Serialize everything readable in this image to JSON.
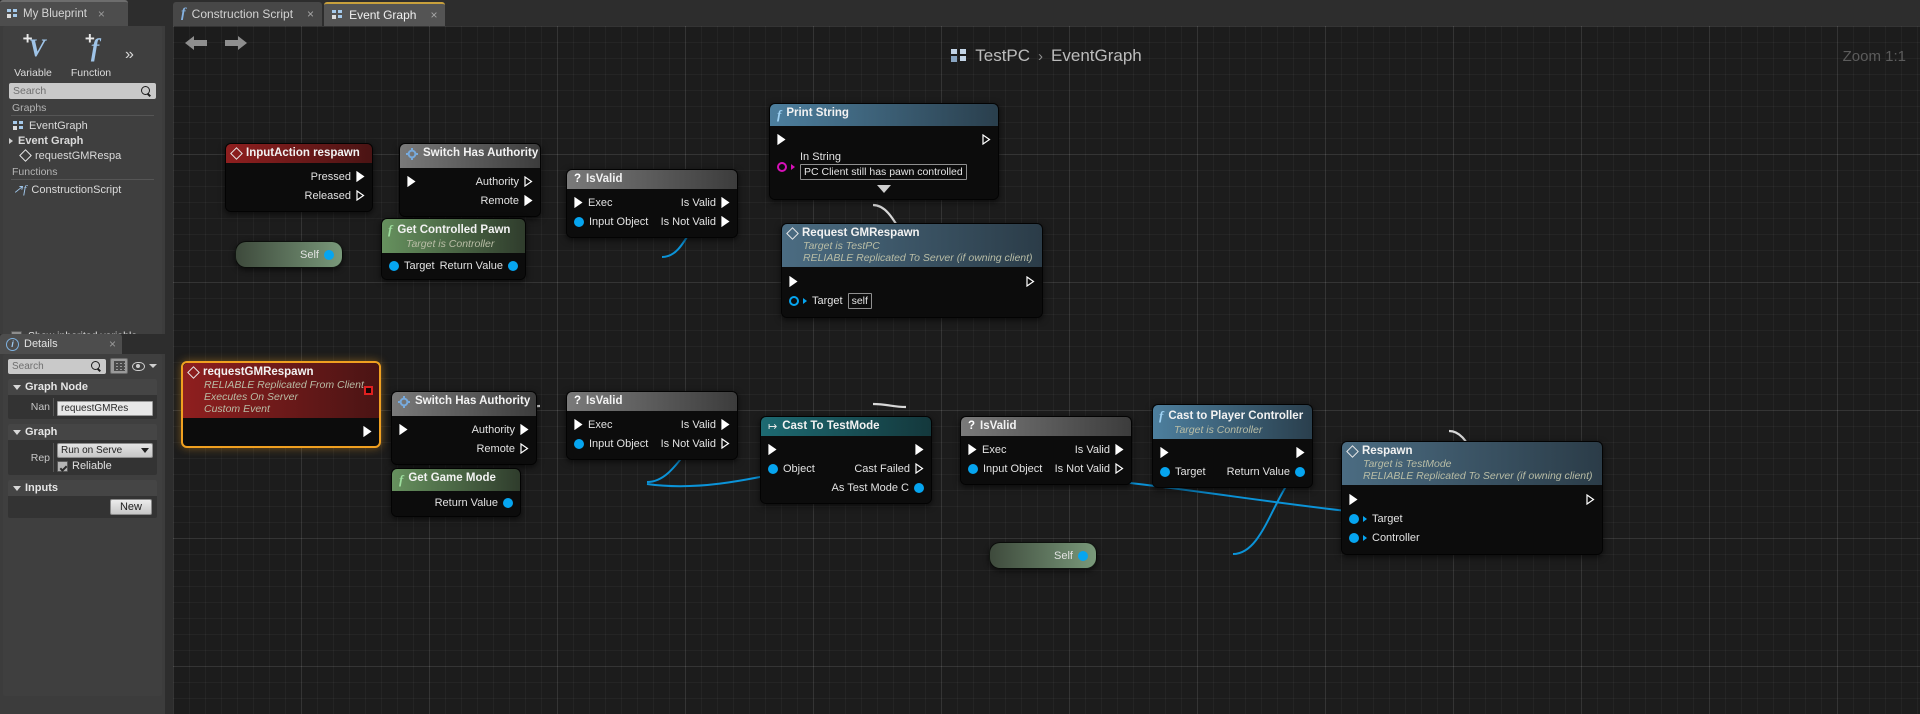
{
  "left_panel": {
    "tab": {
      "label": "My Blueprint",
      "icon": "blueprint-list-icon",
      "close": "×"
    },
    "buttons": [
      {
        "label": "Variable",
        "icon": "add-variable-icon",
        "glyph": "V"
      },
      {
        "label": "Function",
        "icon": "add-function-icon",
        "glyph": "f"
      }
    ],
    "overflow_icon": "double-chevron-icon",
    "search": {
      "placeholder": "Search",
      "value": "",
      "icon": "search-icon"
    },
    "sections": [
      {
        "header": "Graphs"
      },
      {
        "header": "Functions"
      }
    ],
    "tree": [
      {
        "label": "EventGraph",
        "icon": "graph-icon",
        "indent": 0,
        "bold": false
      },
      {
        "label": "Event Graph",
        "icon": "expander-tri-icon",
        "indent": 0,
        "bold": true
      },
      {
        "label": "requestGMRespa",
        "icon": "event-diamond-icon",
        "indent": 1,
        "bold": false
      },
      {
        "label": "ConstructionScript",
        "icon": "construction-script-icon",
        "indent": 0,
        "bold": false
      }
    ],
    "show_inherited": {
      "label": "Show inherited variable",
      "checked": false
    }
  },
  "details_panel": {
    "tab": {
      "label": "Details",
      "icon": "details-info-icon",
      "close": "×"
    },
    "search": {
      "placeholder": "Search",
      "value": "",
      "icon": "search-icon"
    },
    "toolbar_icons": [
      "grid-view-icon",
      "eye-icon",
      "chevron-down-icon"
    ],
    "sections": [
      {
        "title": "Graph Node",
        "rows": [
          {
            "label": "Nan",
            "type": "text",
            "value": "requestGMRes"
          }
        ]
      },
      {
        "title": "Graph",
        "rows": [
          {
            "label": "Rep",
            "type": "dropdown",
            "value": "Run on Serve"
          },
          {
            "label": "",
            "type": "checkbox",
            "value": "Reliable",
            "checked": true
          }
        ]
      },
      {
        "title": "Inputs",
        "rows": [
          {
            "label": "",
            "type": "button",
            "value": "New"
          }
        ]
      }
    ]
  },
  "main": {
    "tabs": [
      {
        "label": "Construction Script",
        "icon": "function-fx-icon",
        "active": false,
        "close": "×"
      },
      {
        "label": "Event Graph",
        "icon": "graph-icon",
        "active": true,
        "close": "×"
      }
    ],
    "toolbar": {
      "back_icon": "back-arrow-icon",
      "forward_icon": "forward-arrow-icon"
    },
    "breadcrumb": {
      "icon": "blueprint-graph-icon",
      "root": "TestPC",
      "separator": "›",
      "leaf": "EventGraph"
    },
    "zoom_label": "Zoom 1:1"
  },
  "nodes": {
    "input_action": {
      "title": "InputAction respawn",
      "icon": "event-diamond-icon",
      "pins": [
        {
          "label": "Pressed",
          "kind": "exec-out",
          "connected": true
        },
        {
          "label": "Released",
          "kind": "exec-out",
          "connected": false
        }
      ]
    },
    "switch_authority_1": {
      "title": "Switch Has Authority",
      "icon": "gear-icon",
      "pins_in": [
        {
          "label": "",
          "kind": "exec-in",
          "connected": true
        }
      ],
      "pins_out": [
        {
          "label": "Authority",
          "kind": "exec-out",
          "connected": false
        },
        {
          "label": "Remote",
          "kind": "exec-out",
          "connected": true
        }
      ]
    },
    "is_valid_1": {
      "title": "IsValid",
      "icon": "question-icon",
      "pins_in": [
        {
          "label": "Exec",
          "kind": "exec-in",
          "connected": true
        },
        {
          "label": "Input Object",
          "kind": "data-in",
          "connected": true
        }
      ],
      "pins_out": [
        {
          "label": "Is Valid",
          "kind": "exec-out",
          "connected": true
        },
        {
          "label": "Is Not Valid",
          "kind": "exec-out",
          "connected": true
        }
      ]
    },
    "get_controlled_pawn": {
      "title": "Get Controlled Pawn",
      "subtitle": "Target is Controller",
      "icon": "function-fx-icon",
      "pins_in": [
        {
          "label": "Target",
          "kind": "data-in",
          "connected": true
        }
      ],
      "pins_out": [
        {
          "label": "Return Value",
          "kind": "data-out",
          "connected": true
        }
      ]
    },
    "self_1": {
      "label": "Self",
      "kind": "self-node"
    },
    "print_string": {
      "title": "Print String",
      "icon": "function-fx-icon",
      "pins_in": [
        {
          "label": "",
          "kind": "exec-in",
          "connected": true
        },
        {
          "label": "In String",
          "kind": "data-in-string",
          "connected": false
        }
      ],
      "pins_out": [
        {
          "label": "",
          "kind": "exec-out",
          "connected": false
        }
      ],
      "in_string_value": "PC Client still has pawn controlled",
      "expander_icon": "chevron-down-icon"
    },
    "request_gmrespawn": {
      "title": "Request GMRespawn",
      "subtitle1": "Target is TestPC",
      "subtitle2": "RELIABLE Replicated To Server (if owning client)",
      "icon": "event-diamond-icon",
      "pins_in": [
        {
          "label": "",
          "kind": "exec-in",
          "connected": true
        },
        {
          "label": "Target",
          "kind": "data-in",
          "connected": false
        }
      ],
      "pins_out": [
        {
          "label": "",
          "kind": "exec-out",
          "connected": false
        }
      ],
      "target_value": "self"
    },
    "custom_event": {
      "title": "requestGMRespawn",
      "subtitle1": "RELIABLE Replicated From Client",
      "subtitle2": "Executes On Server",
      "subtitle3": "Custom Event",
      "icon": "event-diamond-icon",
      "selected": true,
      "delegate_pin": "red-square-pin",
      "pins_out": [
        {
          "label": "",
          "kind": "exec-out",
          "connected": true
        }
      ]
    },
    "switch_authority_2": {
      "title": "Switch Has Authority",
      "icon": "gear-icon",
      "pins_in": [
        {
          "label": "",
          "kind": "exec-in",
          "connected": true
        }
      ],
      "pins_out": [
        {
          "label": "Authority",
          "kind": "exec-out",
          "connected": true
        },
        {
          "label": "Remote",
          "kind": "exec-out",
          "connected": false
        }
      ]
    },
    "is_valid_2": {
      "title": "IsValid",
      "icon": "question-icon",
      "pins_in": [
        {
          "label": "Exec",
          "kind": "exec-in",
          "connected": true
        },
        {
          "label": "Input Object",
          "kind": "data-in",
          "connected": true
        }
      ],
      "pins_out": [
        {
          "label": "Is Valid",
          "kind": "exec-out",
          "connected": true
        },
        {
          "label": "Is Not Valid",
          "kind": "exec-out",
          "connected": false
        }
      ]
    },
    "get_game_mode": {
      "title": "Get Game Mode",
      "icon": "function-fx-icon",
      "pins_out": [
        {
          "label": "Return Value",
          "kind": "data-out",
          "connected": true
        }
      ]
    },
    "cast_to_testmode": {
      "title": "Cast To TestMode",
      "icon": "cast-arrow-icon",
      "pins_in": [
        {
          "label": "",
          "kind": "exec-in",
          "connected": true
        },
        {
          "label": "Object",
          "kind": "data-in",
          "connected": true
        }
      ],
      "pins_out": [
        {
          "label": "",
          "kind": "exec-out",
          "connected": true
        },
        {
          "label": "Cast Failed",
          "kind": "exec-out",
          "connected": false
        },
        {
          "label": "As Test Mode C",
          "kind": "data-out",
          "connected": true
        }
      ]
    },
    "is_valid_3": {
      "title": "IsValid",
      "icon": "question-icon",
      "pins_in": [
        {
          "label": "Exec",
          "kind": "exec-in",
          "connected": true
        },
        {
          "label": "Input Object",
          "kind": "data-in",
          "connected": true
        }
      ],
      "pins_out": [
        {
          "label": "Is Valid",
          "kind": "exec-out",
          "connected": true
        },
        {
          "label": "Is Not Valid",
          "kind": "exec-out",
          "connected": false
        }
      ]
    },
    "cast_player_controller": {
      "title": "Cast to Player Controller",
      "subtitle": "Target is Controller",
      "icon": "function-fx-icon",
      "pins_in": [
        {
          "label": "",
          "kind": "exec-in",
          "connected": true
        },
        {
          "label": "Target",
          "kind": "data-in",
          "connected": true
        }
      ],
      "pins_out": [
        {
          "label": "",
          "kind": "exec-out",
          "connected": true
        },
        {
          "label": "Return Value",
          "kind": "data-out",
          "connected": true
        }
      ]
    },
    "respawn": {
      "title": "Respawn",
      "subtitle1": "Target is TestMode",
      "subtitle2": "RELIABLE Replicated To Server (if owning client)",
      "icon": "event-diamond-icon",
      "pins_in": [
        {
          "label": "",
          "kind": "exec-in",
          "connected": true
        },
        {
          "label": "Target",
          "kind": "data-in",
          "connected": true
        },
        {
          "label": "Controller",
          "kind": "data-in",
          "connected": true
        }
      ],
      "pins_out": [
        {
          "label": "",
          "kind": "exec-out",
          "connected": false
        }
      ]
    },
    "self_2": {
      "label": "Self",
      "kind": "self-node"
    }
  },
  "colors": {
    "exec_wire": "#d8d8d8",
    "data_wire": "#0b93d8",
    "event_header": "#8f1f1f",
    "function_header": "#4a7f4a",
    "pure_function_header": "#5a8c5a",
    "flow_header": "#6a6a6a",
    "cast_header": "#1d6a72",
    "rpc_header": "#48697f",
    "selected_outline": "#f0a020",
    "data_pin": "#06a5f0",
    "string_pin": "#d710b8"
  }
}
